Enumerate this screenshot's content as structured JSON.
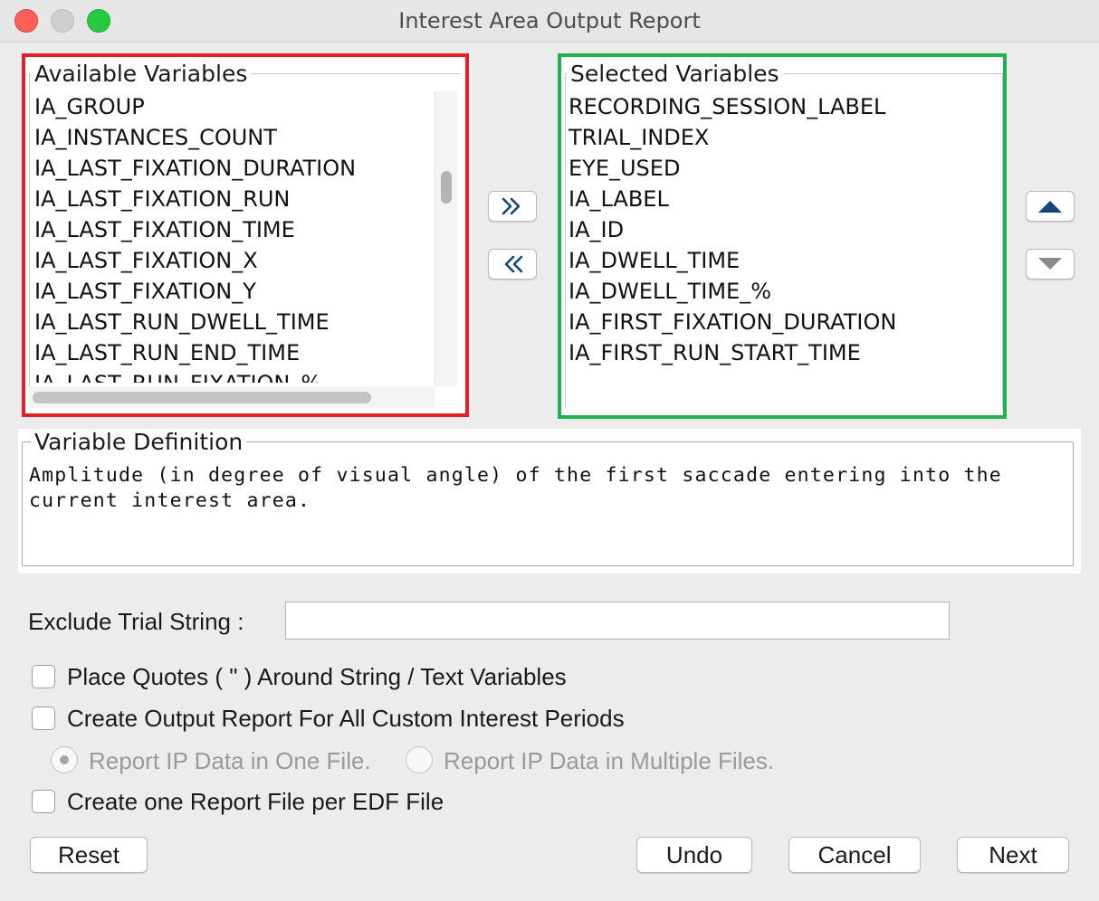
{
  "window": {
    "title": "Interest Area Output Report"
  },
  "available": {
    "legend": "Available Variables",
    "items": [
      "IA_GROUP",
      "IA_INSTANCES_COUNT",
      "IA_LAST_FIXATION_DURATION",
      "IA_LAST_FIXATION_RUN",
      "IA_LAST_FIXATION_TIME",
      "IA_LAST_FIXATION_X",
      "IA_LAST_FIXATION_Y",
      "IA_LAST_RUN_DWELL_TIME",
      "IA_LAST_RUN_END_TIME",
      "IA_LAST_RUN_FIXATION_%"
    ]
  },
  "selected": {
    "legend": "Selected Variables",
    "items": [
      "RECORDING_SESSION_LABEL",
      "TRIAL_INDEX",
      "EYE_USED",
      "IA_LABEL",
      "IA_ID",
      "IA_DWELL_TIME",
      "IA_DWELL_TIME_%",
      "IA_FIRST_FIXATION_DURATION",
      "IA_FIRST_RUN_START_TIME"
    ]
  },
  "definition": {
    "legend": "Variable Definition",
    "text": "Amplitude (in degree of visual angle) of the first saccade entering into the\ncurrent interest area."
  },
  "exclude": {
    "label": "Exclude Trial String :",
    "value": ""
  },
  "options": {
    "quotes_label": "Place Quotes ( \" ) Around String /  Text Variables",
    "custom_ip_label": "Create Output Report For All Custom Interest Periods",
    "ip_one_file_label": "Report IP Data in One File.",
    "ip_multi_file_label": "Report IP Data in Multiple Files.",
    "per_edf_label": "Create one Report File per EDF File"
  },
  "buttons": {
    "reset": "Reset",
    "undo": "Undo",
    "cancel": "Cancel",
    "next": "Next"
  },
  "colors": {
    "available_highlight": "#e51e24",
    "selected_highlight": "#22b14c",
    "arrow_blue": "#15467a"
  }
}
